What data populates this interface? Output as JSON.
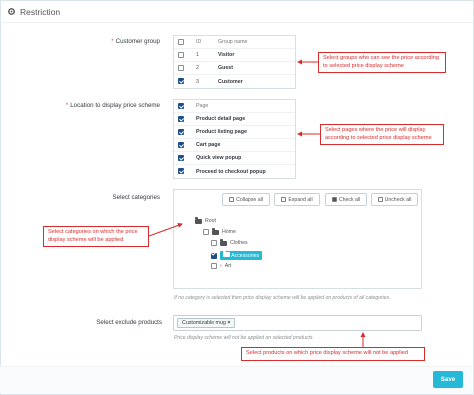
{
  "panel": {
    "title": "Restriction"
  },
  "customer_group": {
    "label": "Customer group",
    "headers": {
      "id": "ID",
      "name": "Group name"
    },
    "rows": [
      {
        "id": "1",
        "name": "Visitor",
        "checked": false
      },
      {
        "id": "2",
        "name": "Guest",
        "checked": false
      },
      {
        "id": "3",
        "name": "Customer",
        "checked": true
      }
    ],
    "callout": "Select groups who can see the price according to selected price display scheme"
  },
  "location": {
    "label": "Location to display price scheme",
    "header": "Page",
    "rows": [
      {
        "name": "Product detail page",
        "checked": true
      },
      {
        "name": "Product listing page",
        "checked": true
      },
      {
        "name": "Cart page",
        "checked": true
      },
      {
        "name": "Quick view popup",
        "checked": true
      },
      {
        "name": "Proceed to checkout popup",
        "checked": true
      }
    ],
    "callout": "Select pages where the price will display according to selected price display scheme"
  },
  "categories": {
    "label": "Select categories",
    "buttons": {
      "collapse": "Collapse all",
      "expand": "Expand all",
      "check": "Check all",
      "uncheck": "Uncheck all"
    },
    "tree": {
      "root": "Root",
      "home": "Home",
      "clothes": "Clothes",
      "accessories": "Accessories",
      "art": "Art"
    },
    "callout": "Select categories on which the price display scheme will be applied",
    "help": "If no category is selected then price display scheme will be applied on products of all categories."
  },
  "exclude": {
    "label": "Select exclude products",
    "tag": "Customizable mug",
    "tag_remove": "×",
    "help": "Price display scheme will not be applied on selected products.",
    "callout": "Select products on which price display scheme will not be applied"
  },
  "footer": {
    "save_label": "Save"
  },
  "colors": {
    "accent": "#25b9d7",
    "callout": "#d92b2b",
    "checkbox": "#1c4f8a"
  }
}
